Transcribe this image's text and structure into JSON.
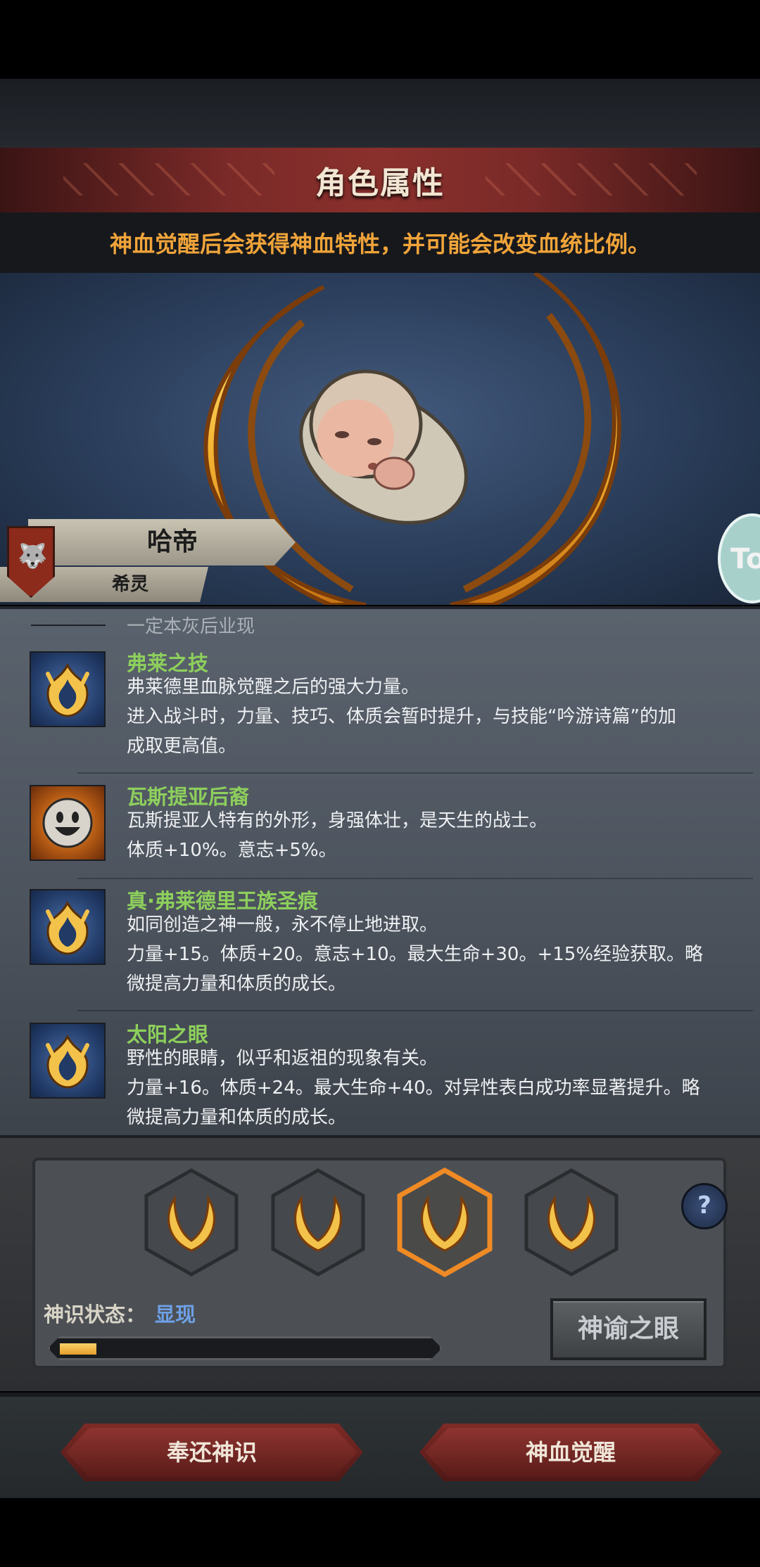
{
  "header": {
    "title": "角色属性"
  },
  "notice": "神血觉醒后会获得神血特性，并可能会改变血统比例。",
  "character": {
    "name": "哈帝",
    "subtitle": "希灵",
    "side_tab_text": "To"
  },
  "trait_list": {
    "cut_off_text": "一定本灰后业现",
    "items": [
      {
        "icon": "flame-crest-icon",
        "name": "弗莱之技",
        "lines": [
          "弗莱德里血脉觉醒之后的强大力量。",
          "进入战斗时，力量、技巧、体质会暂时提升，与技能“吟游诗篇”的加",
          "成取更高值。"
        ]
      },
      {
        "icon": "smiley-sun-icon",
        "name": "瓦斯提亚后裔",
        "lines": [
          "瓦斯提亚人特有的外形，身强体壮，是天生的战士。",
          "体质+10%。意志+5%。"
        ]
      },
      {
        "icon": "flame-crest-icon",
        "name": "真·弗莱德里王族圣痕",
        "lines": [
          "如同创造之神一般，永不停止地进取。",
          "力量+15。体质+20。意志+10。最大生命+30。+15%经验获取。略",
          "微提高力量和体质的成长。"
        ]
      },
      {
        "icon": "flame-crest-icon",
        "name": "太阳之眼",
        "lines": [
          "野性的眼睛，似乎和返祖的现象有关。",
          "力量+16。体质+24。最大生命+40。对异性表白成功率显著提升。略",
          "微提高力量和体质的成长。"
        ]
      }
    ]
  },
  "awakening": {
    "slots": [
      "laurel-icon",
      "laurel-icon",
      "laurel-icon",
      "laurel-icon"
    ],
    "selected_slot": 3,
    "help_label": "?",
    "status_label": "神识状态：",
    "status_value": "显现",
    "progress": 0.1,
    "oracle_button": "神谕之眼"
  },
  "footer": {
    "return_button": "奉还神识",
    "awaken_button": "神血觉醒"
  },
  "colors": {
    "accent_gold": "#f0a43a",
    "trait_name": "#8dcf5c",
    "status_value": "#6ea0e6",
    "button_red": "#7d2a26"
  }
}
